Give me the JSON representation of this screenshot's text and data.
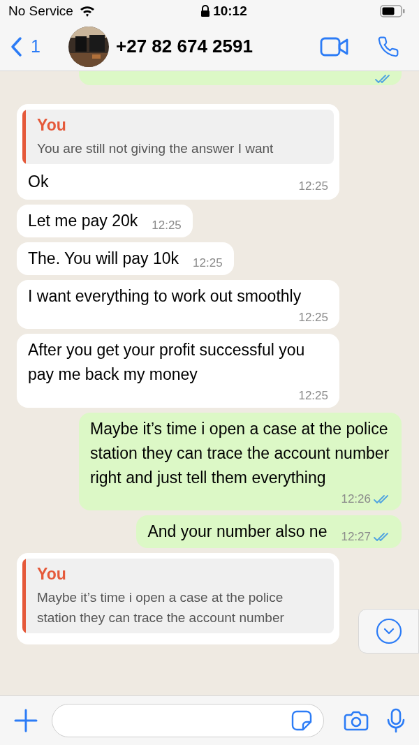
{
  "status_bar": {
    "carrier": "No Service",
    "time": "10:12"
  },
  "header": {
    "back_count": "1",
    "contact": "+27 82 674 2591"
  },
  "top_partial": {
    "kind": "outgoing",
    "read": true
  },
  "messages": [
    {
      "kind": "incoming",
      "quote": {
        "author": "You",
        "text": "You are still not giving the answer I want"
      },
      "text": "Ok",
      "time": "12:25"
    },
    {
      "kind": "incoming",
      "text": "Let me pay 20k",
      "time": "12:25"
    },
    {
      "kind": "incoming",
      "text": "The. You will pay 10k",
      "time": "12:25"
    },
    {
      "kind": "incoming",
      "text": "I want everything to work out smoothly",
      "time": "12:25"
    },
    {
      "kind": "incoming",
      "text": "After you get your profit successful you pay me back my money",
      "time": "12:25"
    },
    {
      "kind": "outgoing",
      "text": "Maybe it’s time i open a case at the police station they can trace the account number right and just tell them everything",
      "time": "12:26",
      "read": true
    },
    {
      "kind": "outgoing",
      "text": "And your number also ne",
      "time": "12:27",
      "read": true
    },
    {
      "kind": "incoming",
      "quote": {
        "author": "You",
        "text": "Maybe it’s time i open a case at the police station they can trace the account number"
      }
    }
  ]
}
